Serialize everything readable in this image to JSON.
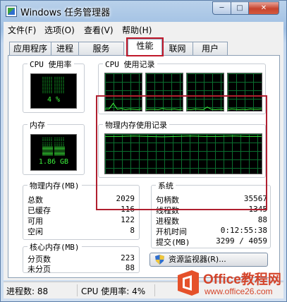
{
  "window": {
    "title": "Windows 任务管理器"
  },
  "caption_buttons": {
    "minimize": "─",
    "maximize": "□",
    "close": "✕"
  },
  "menu": [
    "文件(F)",
    "选项(O)",
    "查看(V)",
    "帮助(H)"
  ],
  "tabs": [
    "应用程序",
    "进程",
    "服务",
    "性能",
    "联网",
    "用户"
  ],
  "active_tab": "性能",
  "performance": {
    "cpu_usage": {
      "label": "CPU 使用率",
      "value": "4 %",
      "percent": 4
    },
    "cpu_history": {
      "label": "CPU 使用记录",
      "cores": 4
    },
    "memory": {
      "label": "内存",
      "value": "1.86 GB",
      "fraction": 0.47
    },
    "memory_history": {
      "label": "物理内存使用记录"
    },
    "physical_memory": {
      "label": "物理内存(MB)",
      "rows": [
        {
          "label": "总数",
          "value": "2029"
        },
        {
          "label": "已缓存",
          "value": "116"
        },
        {
          "label": "可用",
          "value": "122"
        },
        {
          "label": "空闲",
          "value": "8"
        }
      ]
    },
    "kernel_memory": {
      "label": "核心内存(MB)",
      "rows": [
        {
          "label": "分页数",
          "value": "223"
        },
        {
          "label": "未分页",
          "value": "88"
        }
      ]
    },
    "system": {
      "label": "系统",
      "rows": [
        {
          "label": "句柄数",
          "value": "35567"
        },
        {
          "label": "线程数",
          "value": "1345"
        },
        {
          "label": "进程数",
          "value": "88"
        },
        {
          "label": "开机时间",
          "value": "0:12:55:38"
        },
        {
          "label": "提交(MB)",
          "value": "3299 / 4059"
        }
      ]
    },
    "resource_monitor_button": "资源监视器(R)..."
  },
  "status_bar": {
    "processes": "进程数: 88",
    "cpu": "CPU 使用率: 4%"
  },
  "watermark": {
    "title": "Office教程网",
    "url": "www.office26.com"
  },
  "colors": {
    "graph_line": "#3cf43c",
    "grid": "#0b6e2f",
    "highlight": "#c0182a"
  }
}
